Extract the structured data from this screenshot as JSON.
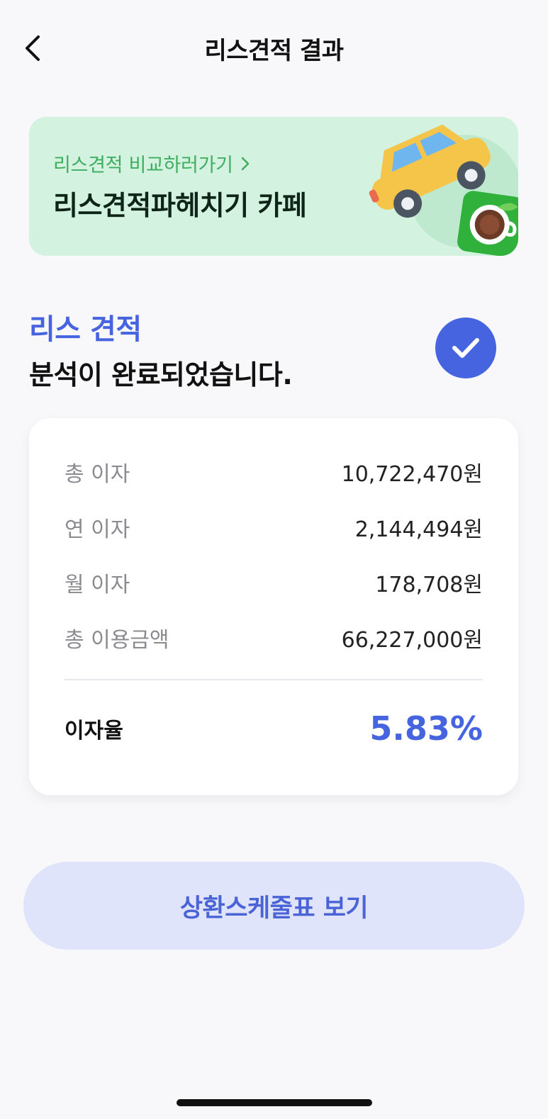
{
  "header": {
    "title": "리스견적 결과",
    "back_icon": "chevron-left-icon"
  },
  "banner": {
    "link_label": "리스견적 비교하러가기",
    "link_icon": "chevron-right-icon",
    "title": "리스견적파헤치기 카페",
    "background_color": "#d3f2df",
    "link_color": "#3fae60"
  },
  "result": {
    "heading_line1": "리스 견적",
    "heading_line2": "분석이 완료되었습니다.",
    "status_icon": "check-circle-icon",
    "accent_color": "#4663e0"
  },
  "summary": {
    "rows": [
      {
        "label": "총 이자",
        "value": "10,722,470원"
      },
      {
        "label": "연 이자",
        "value": "2,144,494원"
      },
      {
        "label": "월 이자",
        "value": "178,708원"
      },
      {
        "label": "총 이용금액",
        "value": "66,227,000원"
      }
    ],
    "rate_label": "이자율",
    "rate_value": "5.83%"
  },
  "actions": {
    "schedule_button_label": "상환스케줄표 보기"
  }
}
